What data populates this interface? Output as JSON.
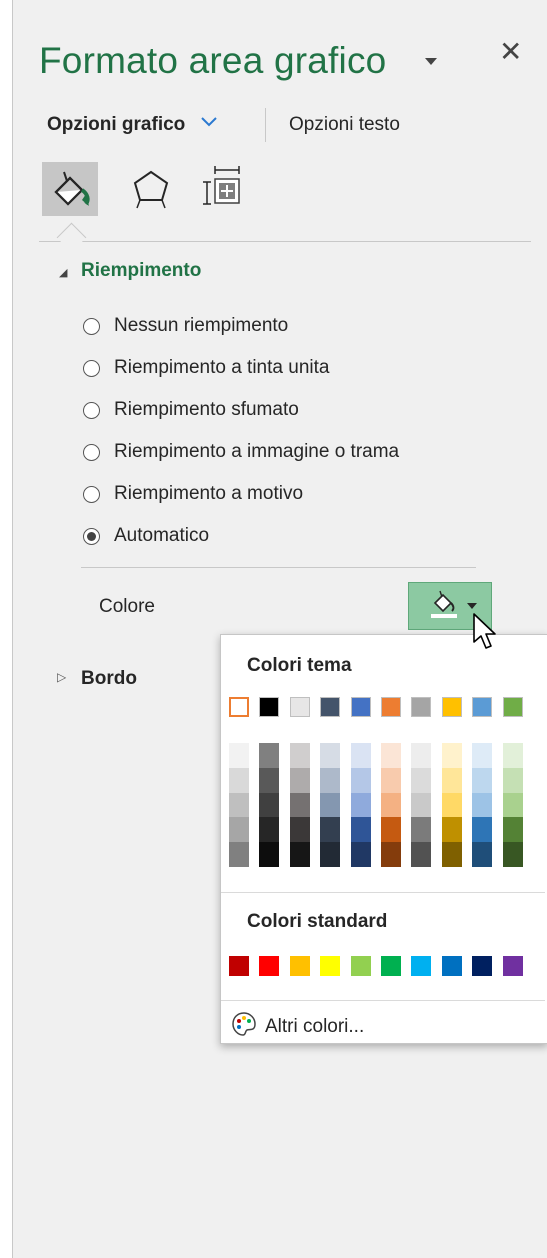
{
  "pane": {
    "title": "Formato area grafico",
    "close_glyph": "✕",
    "tabs": {
      "active": "Opzioni grafico",
      "other": "Opzioni testo"
    },
    "icons": [
      "fill-line-icon",
      "effects-pentagon-icon",
      "size-properties-icon"
    ]
  },
  "fill_section": {
    "title": "Riempimento",
    "options": [
      {
        "label": "Nessun riempimento",
        "selected": false
      },
      {
        "label": "Riempimento a tinta unita",
        "selected": false
      },
      {
        "label": "Riempimento sfumato",
        "selected": false
      },
      {
        "label": "Riempimento a immagine o trama",
        "selected": false
      },
      {
        "label": "Riempimento a motivo",
        "selected": false
      },
      {
        "label": "Automatico",
        "selected": true
      }
    ],
    "color_label": "Colore"
  },
  "border_section": {
    "title": "Bordo"
  },
  "color_picker": {
    "theme_title": "Colori tema",
    "theme_base": [
      "#ffffff",
      "#000000",
      "#e7e6e6",
      "#44546a",
      "#4472c4",
      "#ed7d31",
      "#a5a5a5",
      "#ffc000",
      "#5b9bd5",
      "#70ad47"
    ],
    "theme_shades": [
      [
        "#f2f2f2",
        "#d9d9d9",
        "#bfbfbf",
        "#a6a6a6",
        "#808080"
      ],
      [
        "#808080",
        "#595959",
        "#404040",
        "#262626",
        "#0d0d0d"
      ],
      [
        "#d0cece",
        "#aeabab",
        "#757171",
        "#3b3838",
        "#161616"
      ],
      [
        "#d6dce5",
        "#adb9ca",
        "#8497b0",
        "#333f50",
        "#222a35"
      ],
      [
        "#dae3f3",
        "#b4c7e7",
        "#8faadc",
        "#2f5597",
        "#203864"
      ],
      [
        "#fbe5d6",
        "#f8cbad",
        "#f4b183",
        "#c55a11",
        "#843c0c"
      ],
      [
        "#ededed",
        "#dbdbdb",
        "#c9c9c9",
        "#7b7b7b",
        "#525252"
      ],
      [
        "#fff2cc",
        "#ffe699",
        "#ffd966",
        "#bf9000",
        "#7f6000"
      ],
      [
        "#deebf7",
        "#bdd7ee",
        "#9dc3e6",
        "#2e75b6",
        "#1f4e79"
      ],
      [
        "#e2f0d9",
        "#c5e0b4",
        "#a9d18e",
        "#548235",
        "#385723"
      ]
    ],
    "selected_index": 0,
    "standard_title": "Colori standard",
    "standard": [
      "#c00000",
      "#ff0000",
      "#ffc000",
      "#ffff00",
      "#92d050",
      "#00b050",
      "#00b0f0",
      "#0070c0",
      "#002060",
      "#7030a0"
    ],
    "more_label": "Altri colori..."
  },
  "colors": {
    "accent_green": "#217346",
    "button_green": "#8cc9a2",
    "selected_orange": "#ed7d31"
  }
}
